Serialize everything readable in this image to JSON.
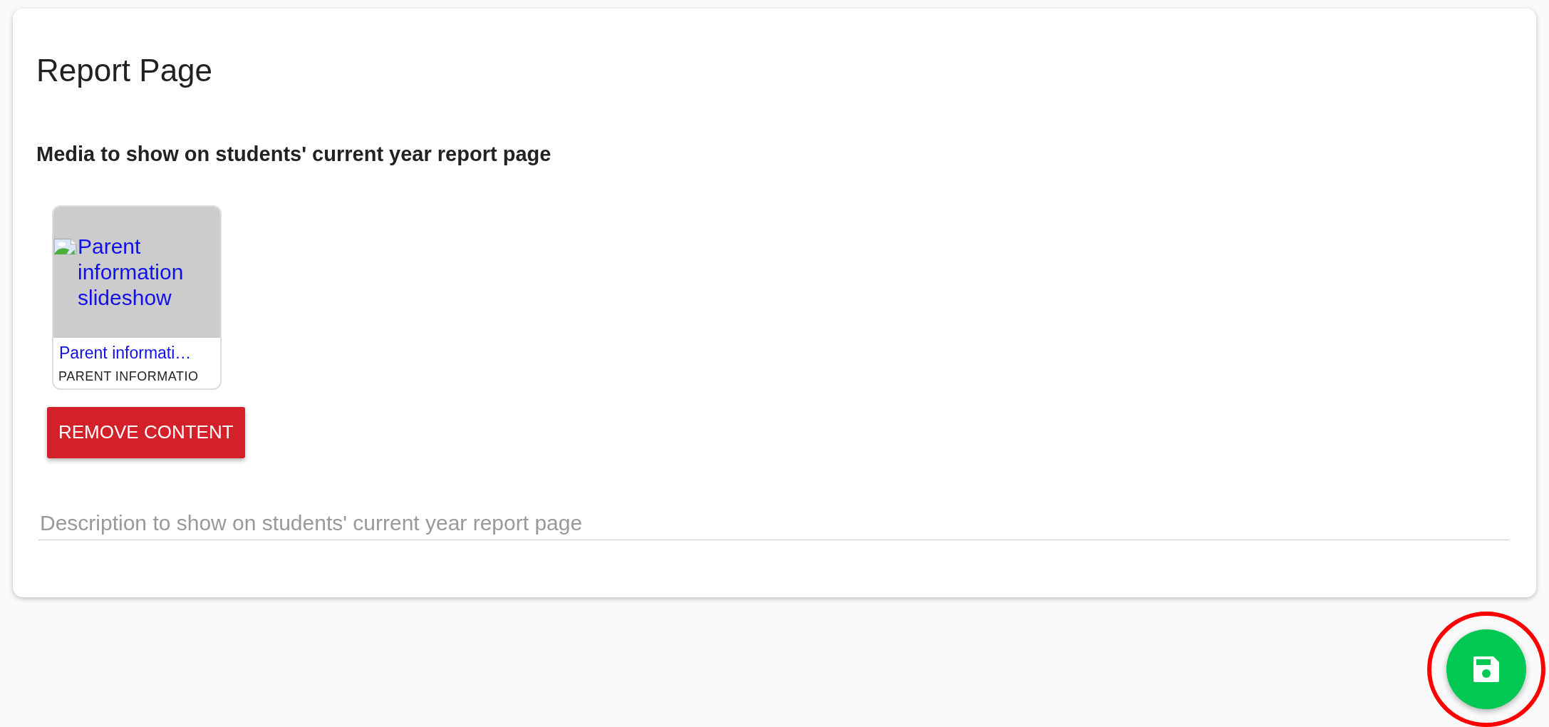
{
  "page": {
    "title": "Report Page"
  },
  "media_section": {
    "heading": "Media to show on students' current year report page",
    "items": [
      {
        "kind": "broken-image",
        "alt": "Parent information slideshow",
        "title": "Parent informati…",
        "subtitle": "PARENT INFORMATIO"
      }
    ],
    "remove_button": "REMOVE CONTENT"
  },
  "description_field": {
    "placeholder": "Description to show on students' current year report page"
  },
  "save_button": {
    "highlighted": true
  }
}
